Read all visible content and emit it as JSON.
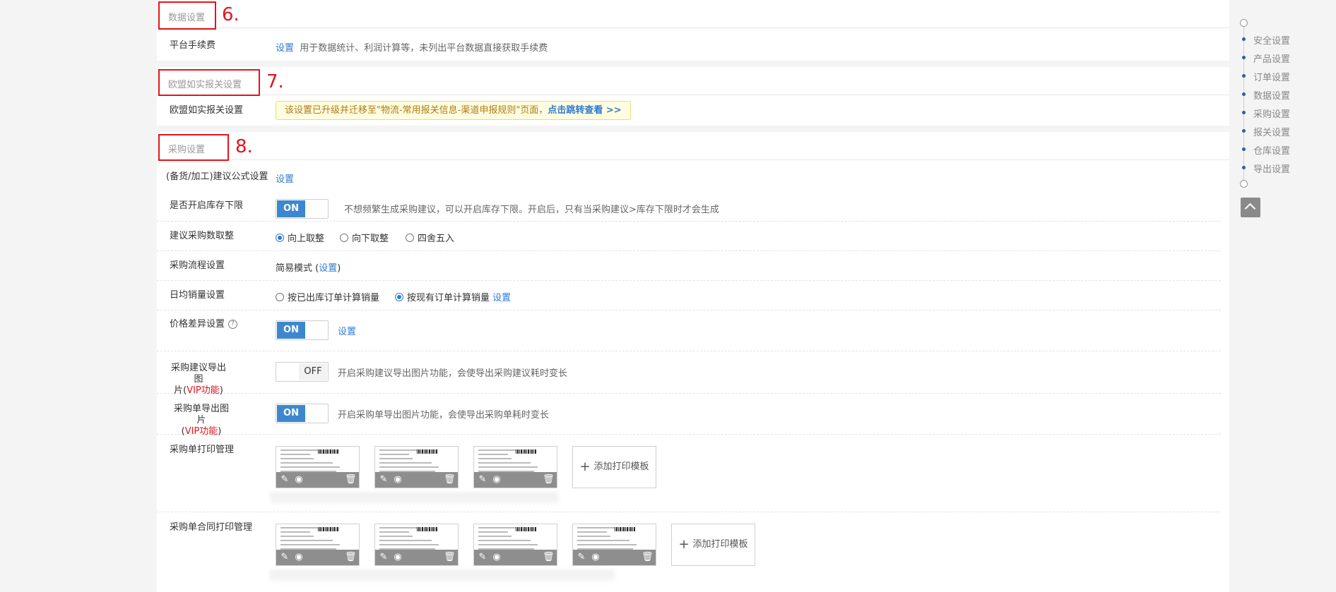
{
  "annotations": [
    "6.",
    "7.",
    "8."
  ],
  "data_section": {
    "title": "数据设置",
    "fee_label": "平台手续费",
    "fee_link": "设置",
    "fee_desc": "用于数据统计、利润计算等，未列出平台数据直接获取手续费"
  },
  "eu_section": {
    "title": "欧盟如实报关设置",
    "row_label": "欧盟如实报关设置",
    "notice_text": "该设置已升级并迁移至\"物流-常用报关信息-渠道申报规则\"页面，",
    "notice_link": "点击跳转查看 >>"
  },
  "purchase_section": {
    "title": "采购设置",
    "formula": {
      "label": "(备货/加工)建议公式设置",
      "link": "设置"
    },
    "stock_limit": {
      "label": "是否开启库存下限",
      "toggle": "ON",
      "desc": "不想频繁生成采购建议，可以开启库存下限。开启后，只有当采购建议>库存下限时才会生成"
    },
    "rounding": {
      "label": "建议采购数取整",
      "options": [
        "向上取整",
        "向下取整",
        "四舍五入"
      ],
      "selected": "向上取整"
    },
    "flow": {
      "label": "采购流程设置",
      "mode": "简易模式",
      "open": "(",
      "link": "设置",
      "close": ")"
    },
    "daily_sales": {
      "label": "日均销量设置",
      "options": [
        "按已出库订单计算销量",
        "按现有订单计算销量"
      ],
      "selected": "按现有订单计算销量",
      "link": "设置"
    },
    "price_diff": {
      "label": "价格差异设置",
      "help_icon": "?",
      "toggle": "ON",
      "link": "设置"
    },
    "suggest_export": {
      "label_line1": "采购建议导出图",
      "label_line2_pre": "片(",
      "vip": "VIP功能",
      "label_line2_post": ")",
      "toggle": "OFF",
      "desc": "开启采购建议导出图片功能，会使导出采购建议耗时变长"
    },
    "order_export": {
      "label_line1": "采购单导出图片",
      "label_line2_pre": "(",
      "vip": "VIP功能",
      "label_line2_post": ")",
      "toggle": "ON",
      "desc": "开启采购单导出图片功能，会使导出采购单耗时变长"
    },
    "print_mgmt": {
      "label": "采购单打印管理",
      "add_label": "添加打印模板"
    },
    "contract_print": {
      "label": "采购单合同打印管理",
      "add_label": "添加打印模板"
    }
  },
  "side_nav": {
    "items": [
      "安全设置",
      "产品设置",
      "订单设置",
      "数据设置",
      "采购设置",
      "报关设置",
      "仓库设置",
      "导出设置"
    ]
  },
  "colors": {
    "accent": "#3d87cf",
    "link": "#2f7bd3",
    "annotation": "#e0151c"
  }
}
